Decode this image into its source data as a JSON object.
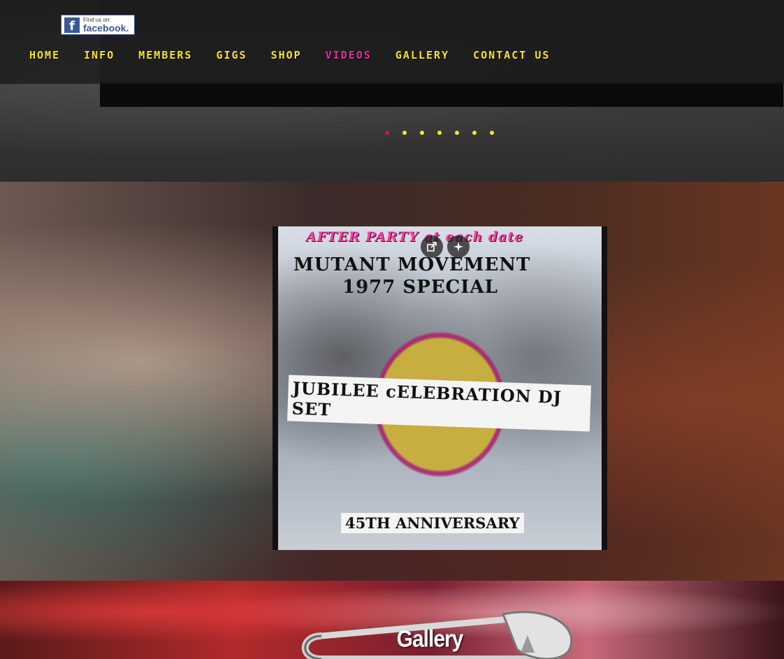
{
  "header": {
    "facebook_badge": {
      "small": "Find us on:",
      "big": "facebook."
    },
    "menu": [
      {
        "label": "Home",
        "active": false
      },
      {
        "label": "Info",
        "active": false
      },
      {
        "label": "Members",
        "active": false
      },
      {
        "label": "Gigs",
        "active": false
      },
      {
        "label": "Shop",
        "active": false
      },
      {
        "label": "Videos",
        "active": true
      },
      {
        "label": "Gallery",
        "active": false
      },
      {
        "label": "Contact Us",
        "active": false
      }
    ],
    "nav_color": "#f7e52d",
    "active_color": "#e0309a"
  },
  "slideshow": {
    "dot_count": 7,
    "active_index": 0
  },
  "video": {
    "lines": {
      "after_party": "AFTER PARTY at each date",
      "title_1": "MUTANT MOVEMENT",
      "title_2": "1977 SPECIAL",
      "banner": "JUBILEE cELEBRATION DJ SET",
      "anniversary": "45TH ANNIVERSARY"
    },
    "buttons": {
      "share": "share-icon",
      "enhance": "sparkle-icon"
    }
  },
  "gallery_section": {
    "title": "Gallery"
  }
}
